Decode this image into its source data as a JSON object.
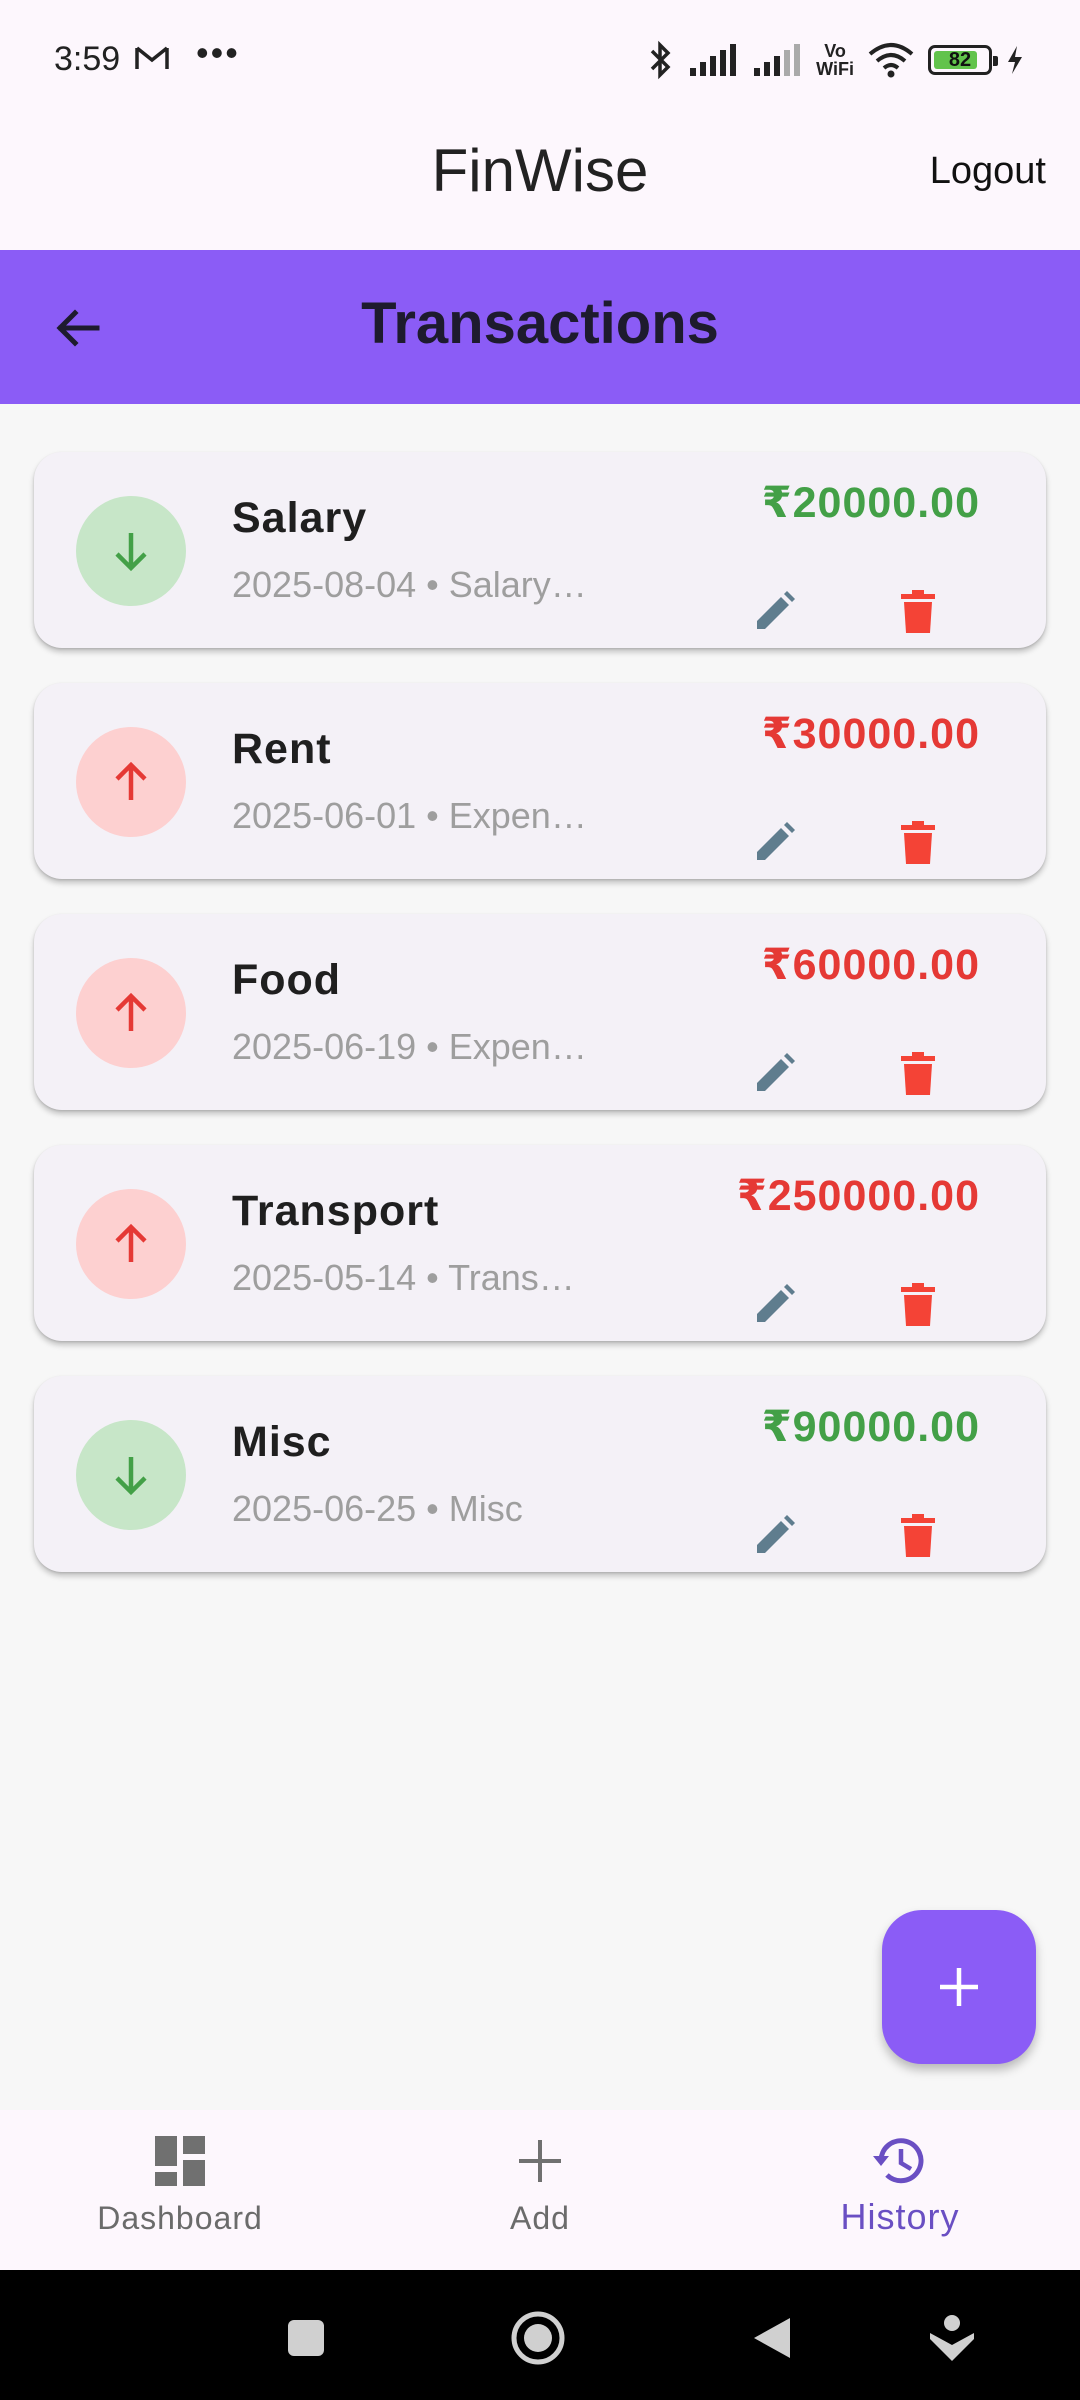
{
  "status_bar": {
    "time": "3:59",
    "dots": "•••",
    "vowifi_top": "Vo",
    "vowifi_bottom": "WiFi",
    "battery_level": "82",
    "battery_fraction": 0.82
  },
  "app_bar": {
    "title": "FinWise",
    "logout_label": "Logout"
  },
  "header": {
    "title": "Transactions"
  },
  "transactions": [
    {
      "title": "Salary",
      "subtitle": "2025-08-04 • Salary…",
      "amount": "₹20000.00",
      "type": "income"
    },
    {
      "title": "Rent",
      "subtitle": "2025-06-01 • Expen…",
      "amount": "₹30000.00",
      "type": "expense"
    },
    {
      "title": "Food",
      "subtitle": "2025-06-19 • Expen…",
      "amount": "₹60000.00",
      "type": "expense"
    },
    {
      "title": "Transport",
      "subtitle": "2025-05-14 • Trans…",
      "amount": "₹250000.00",
      "type": "expense"
    },
    {
      "title": "Misc",
      "subtitle": "2025-06-25 • Misc",
      "amount": "₹90000.00",
      "type": "income"
    }
  ],
  "bottom_nav": {
    "items": [
      {
        "label": "Dashboard",
        "icon": "dashboard-icon"
      },
      {
        "label": "Add",
        "icon": "add-icon"
      },
      {
        "label": "History",
        "icon": "history-icon",
        "active": true
      }
    ]
  },
  "colors": {
    "accent": "#8b5cf6",
    "income": "#43a047",
    "expense": "#e53935",
    "edit": "#5f7d8e",
    "delete": "#f44336"
  }
}
